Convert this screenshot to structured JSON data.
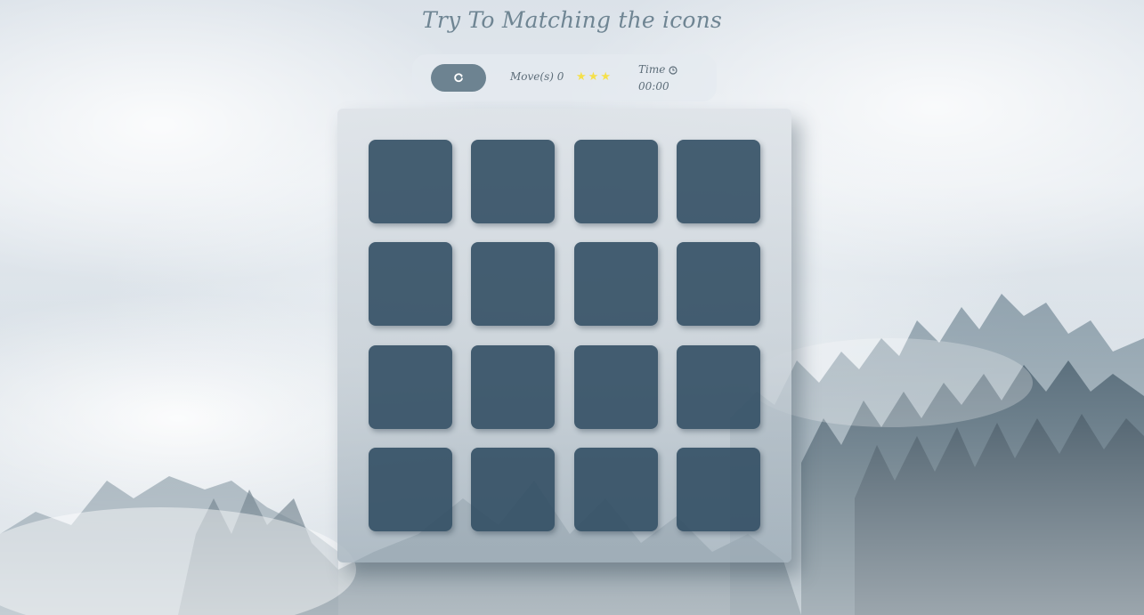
{
  "header": {
    "title": "Try To Matching the icons"
  },
  "score_panel": {
    "restart_icon": "restart-icon",
    "moves_label": "Move(s) 0",
    "stars": {
      "filled": 3,
      "total": 3,
      "color": "#f5e04a",
      "icon": "star-icon"
    },
    "time_label": "Time",
    "clock_icon": "clock-icon",
    "time_value": "00:00"
  },
  "deck": {
    "rows": 4,
    "columns": 4,
    "cards": [
      {
        "state": "hidden"
      },
      {
        "state": "hidden"
      },
      {
        "state": "hidden"
      },
      {
        "state": "hidden"
      },
      {
        "state": "hidden"
      },
      {
        "state": "hidden"
      },
      {
        "state": "hidden"
      },
      {
        "state": "hidden"
      },
      {
        "state": "hidden"
      },
      {
        "state": "hidden"
      },
      {
        "state": "hidden"
      },
      {
        "state": "hidden"
      },
      {
        "state": "hidden"
      },
      {
        "state": "hidden"
      },
      {
        "state": "hidden"
      },
      {
        "state": "hidden"
      }
    ]
  },
  "colors": {
    "card_back": "#2f4b61",
    "button": "#6d8391",
    "title": "#6f8593"
  }
}
